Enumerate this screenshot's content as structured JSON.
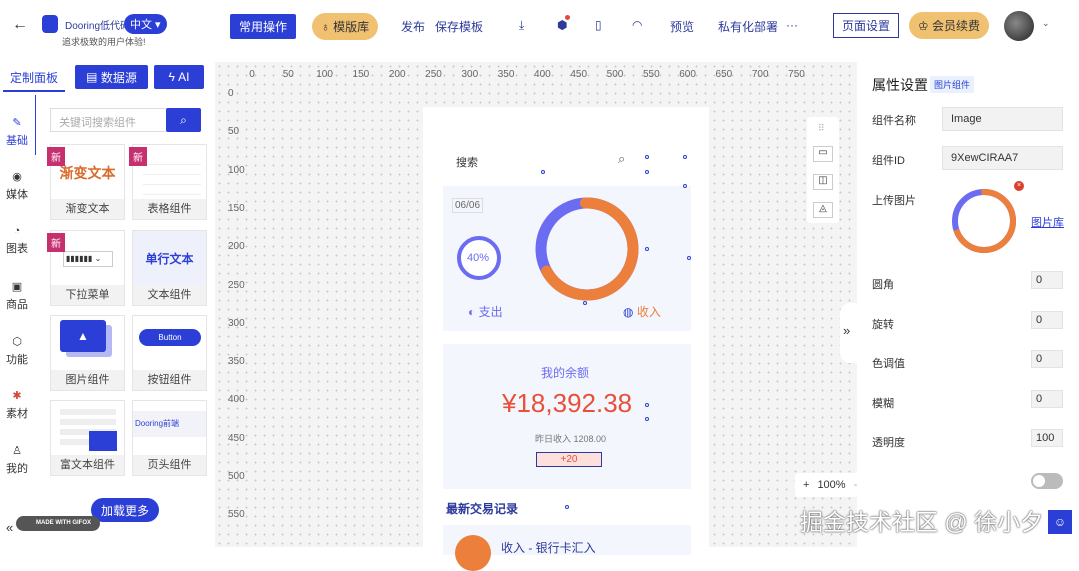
{
  "header": {
    "app_name": "Dooring低代码",
    "subtitle": "追求极致的用户体验!",
    "language": "中文",
    "common_ops": "常用操作",
    "template_lib": "模版库",
    "publish": "发布",
    "save_template": "保存模板",
    "preview": "预览",
    "private_deploy": "私有化部署",
    "more": "···",
    "page_settings": "页面设置",
    "membership": "会员续费"
  },
  "left_panel": {
    "tabs": [
      "定制面板",
      "数据源",
      "AI"
    ],
    "search_placeholder": "关键词搜索组件",
    "categories": [
      "基础",
      "媒体",
      "图表",
      "商品",
      "功能",
      "素材",
      "我的"
    ],
    "components": [
      {
        "label": "渐变文本",
        "preview": "渐变文本",
        "new": "新"
      },
      {
        "label": "表格组件",
        "new": "新"
      },
      {
        "label": "下拉菜单",
        "new": "新"
      },
      {
        "label": "文本组件",
        "preview": "单行文本"
      },
      {
        "label": "图片组件"
      },
      {
        "label": "按钮组件",
        "preview": "Button"
      },
      {
        "label": "富文本组件"
      },
      {
        "label": "页头组件",
        "preview": "Dooring前端"
      }
    ],
    "load_more": "加载更多",
    "made_with": "MADE WITH GIFOX"
  },
  "ruler": {
    "x": [
      "0",
      "50",
      "100",
      "150",
      "200",
      "250",
      "300",
      "350",
      "400",
      "450",
      "500",
      "550",
      "600",
      "650",
      "700",
      "750"
    ],
    "y": [
      "0",
      "50",
      "100",
      "150",
      "200",
      "250",
      "300",
      "350",
      "400",
      "450",
      "500",
      "550"
    ]
  },
  "phone": {
    "search": "搜索",
    "date": "06/06",
    "percent": "40%",
    "percent_value": 40,
    "expense": "支出",
    "income": "收入",
    "balance_label": "我的余额",
    "balance": "¥18,392.38",
    "yesterday": "昨日收入 1208.00",
    "delta": "+20",
    "recent": "最新交易记录",
    "tx": "收入 - 银行卡汇入"
  },
  "zoom": {
    "level": "100%",
    "plus": "+",
    "minus": "-"
  },
  "props": {
    "title": "属性设置",
    "tag": "图片组件",
    "name_label": "组件名称",
    "name_value": "Image",
    "id_label": "组件ID",
    "id_value": "9XewCIRAA7",
    "upload_label": "上传图片",
    "gallery": "图片库",
    "fields": [
      {
        "label": "圆角",
        "value": "0"
      },
      {
        "label": "旋转",
        "value": "0"
      },
      {
        "label": "色调值",
        "value": "0"
      },
      {
        "label": "模糊",
        "value": "0"
      },
      {
        "label": "透明度",
        "value": "100"
      }
    ]
  },
  "watermark": "掘金技术社区 @ 徐小夕",
  "colors": {
    "primary": "#2b3fd6",
    "gold": "#f0c170",
    "orange": "#ec7f3c",
    "purple": "#6b6cf2",
    "red": "#e8503a"
  }
}
